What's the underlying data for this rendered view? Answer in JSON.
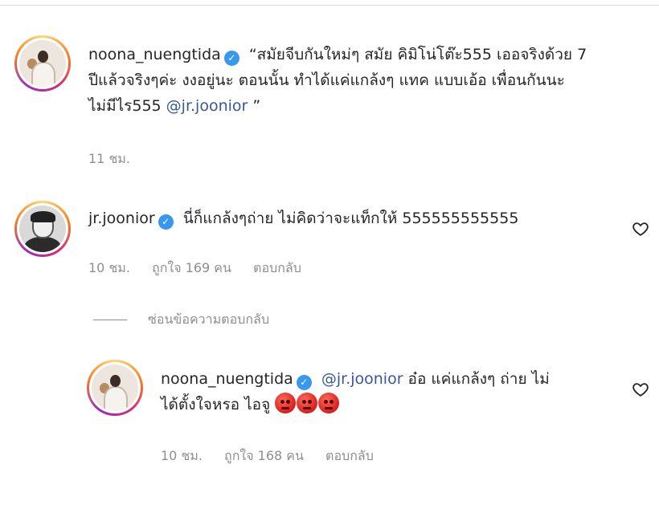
{
  "comments": [
    {
      "username": "noona_nuengtida",
      "verified": true,
      "text_line1": "“สมัยจีบกันใหม่ๆ สมัย คิมิโน่โต๊ะ555 เออจริงด้วย 7",
      "text_line2": "ปีแล้วจริงๆค่ะ งงอยู่นะ ตอนนั้น ทำได้แค่แกล้งๆ แทค แบบเอ้อ เพื่อนกันนะ",
      "text_line3_prefix": "ไม่มีไร555 ",
      "mention": "@jr.joonior",
      "text_line3_suffix": " ”",
      "time": "11 ชม."
    },
    {
      "username": "jr.joonior",
      "verified": true,
      "text": "นี่ก็แกล้งๆถ่าย ไม่คิดว่าจะแท็กให้ 555555555555",
      "time": "10 ชม.",
      "likes": "ถูกใจ 169 คน",
      "reply_label": "ตอบกลับ"
    }
  ],
  "hide_replies_label": "ซ่อนข้อความตอบกลับ",
  "reply": {
    "username": "noona_nuengtida",
    "verified": true,
    "mention": "@jr.joonior",
    "text_line1_suffix": " อ๋อ แค่แกล้งๆ ถ่าย ไม่",
    "text_line2": "ได้ตั้งใจหรอ ไอจู ",
    "emoji_count": 3,
    "emoji_name": "angry-face",
    "time": "10 ชม.",
    "likes": "ถูกใจ 168 คน",
    "reply_label": "ตอบกลับ"
  },
  "colors": {
    "verified": "#3897f0",
    "mention": "#385898",
    "meta": "#8e8e8e"
  }
}
